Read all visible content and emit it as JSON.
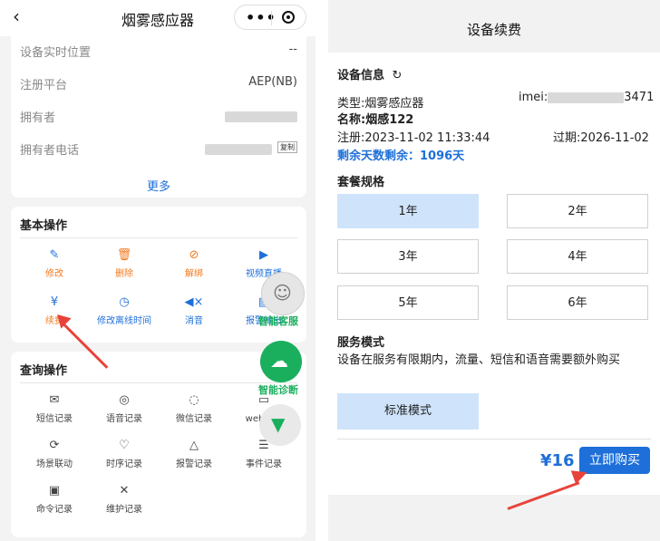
{
  "left": {
    "title": "烟雾感应器",
    "back_icon": "‹",
    "info": {
      "rows": [
        {
          "label": "设备实时位置",
          "value": "--"
        },
        {
          "label": "注册平台",
          "value": "AEP(NB)"
        },
        {
          "label": "拥有者",
          "value": ""
        },
        {
          "label": "拥有者电话",
          "value": "",
          "copy": "复制"
        }
      ],
      "more": "更多"
    },
    "basic": {
      "title": "基本操作",
      "items": [
        {
          "label": "修改",
          "icon": "edit-icon"
        },
        {
          "label": "删除",
          "icon": "trash-icon"
        },
        {
          "label": "解绑",
          "icon": "unbind-icon"
        },
        {
          "label": "视频直播",
          "icon": "play-icon"
        },
        {
          "label": "续费",
          "icon": "renew-icon"
        },
        {
          "label": "修改离线时间",
          "icon": "clock-icon"
        },
        {
          "label": "消音",
          "icon": "mute-icon"
        },
        {
          "label": "报警输出",
          "icon": "alarm-output-icon"
        }
      ]
    },
    "query": {
      "title": "查询操作",
      "items": [
        {
          "label": "短信记录",
          "icon": "mail-icon"
        },
        {
          "label": "语音记录",
          "icon": "voice-icon"
        },
        {
          "label": "微信记录",
          "icon": "chat-icon"
        },
        {
          "label": "web推送",
          "icon": "monitor-icon"
        },
        {
          "label": "场景联动",
          "icon": "scene-icon"
        },
        {
          "label": "时序记录",
          "icon": "heartbeat-icon"
        },
        {
          "label": "报警记录",
          "icon": "siren-icon"
        },
        {
          "label": "事件记录",
          "icon": "event-icon"
        },
        {
          "label": "命令记录",
          "icon": "terminal-icon"
        },
        {
          "label": "维护记录",
          "icon": "tools-icon"
        }
      ]
    },
    "floating": {
      "service": "智能客服",
      "diagnosis": "智能诊断"
    }
  },
  "right": {
    "title": "设备续费",
    "device_info_title": "设备信息",
    "type_text": "类型:烟雾感应器",
    "imei_prefix": "imei:",
    "imei_suffix": "3471",
    "name_text": "名称:烟感122",
    "register_text": "注册:2023-11-02 11:33:44",
    "expire_text": "过期:2026-11-02",
    "remaining_text": "剩余天数剩余：1096天",
    "plan_title": "套餐规格",
    "plans": [
      "1年",
      "2年",
      "3年",
      "4年",
      "5年",
      "6年"
    ],
    "selected_plan": "1年",
    "service_title": "服务模式",
    "service_desc": "设备在服务有限期内，流量、短信和语音需要额外购买",
    "service_mode": "标准模式",
    "price": "¥16",
    "buy_label": "立即购买"
  },
  "colors": {
    "accent": "#1e6fd9",
    "orange": "#f37a1f",
    "arrow": "#e8433a",
    "selected_bg": "#cfe3fb"
  }
}
